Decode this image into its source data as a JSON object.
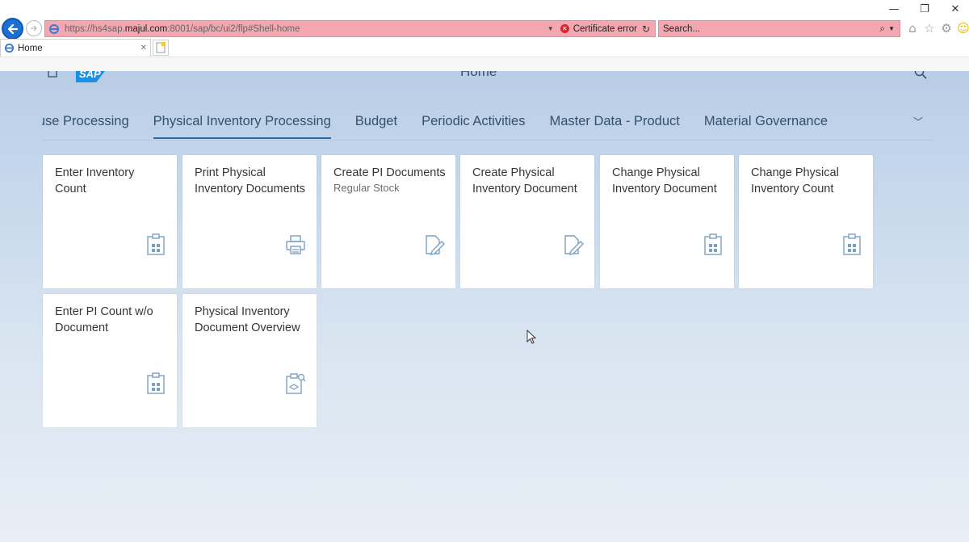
{
  "browser": {
    "window_controls": {
      "minimize": "—",
      "restore": "❐",
      "close": "✕"
    },
    "address": {
      "url_prefix": "https://hs4sap.",
      "url_host": "majul.com",
      "url_suffix": ":8001/sap/bc/ui2/flp#Shell-home",
      "certificate_label": "Certificate error"
    },
    "search": {
      "placeholder": "Search..."
    },
    "tab": {
      "title": "Home"
    },
    "colors": {
      "insecure_bar": "#f3a7b1",
      "back_button": "#1e6fd0"
    }
  },
  "shell": {
    "title": "Home",
    "logo_text": "SAP"
  },
  "anchor_bar": {
    "items": [
      {
        "label": "House Processing",
        "visible_label": "iouse Processing"
      },
      {
        "label": "Physical Inventory Processing",
        "selected": true
      },
      {
        "label": "Budget"
      },
      {
        "label": "Periodic Activities"
      },
      {
        "label": "Master Data - Product"
      },
      {
        "label": "Material Governance"
      }
    ]
  },
  "tiles": [
    {
      "title": "Enter Inventory Count",
      "subtitle": "",
      "icon": "clipboard-icon"
    },
    {
      "title": "Print Physical Inventory Documents",
      "subtitle": "",
      "icon": "printer-icon"
    },
    {
      "title": "Create PI Documents",
      "subtitle": "Regular Stock",
      "icon": "edit-document-icon"
    },
    {
      "title": "Create Physical Inventory Document",
      "subtitle": "",
      "icon": "edit-document-icon"
    },
    {
      "title": "Change Physical Inventory Document",
      "subtitle": "",
      "icon": "clipboard-icon"
    },
    {
      "title": "Change Physical Inventory Count",
      "subtitle": "",
      "icon": "clipboard-icon"
    },
    {
      "title": "Enter PI Count w/o Document",
      "subtitle": "",
      "icon": "clipboard-icon"
    },
    {
      "title": "Physical Inventory Document Overview",
      "subtitle": "",
      "icon": "clipboard-search-icon"
    }
  ]
}
